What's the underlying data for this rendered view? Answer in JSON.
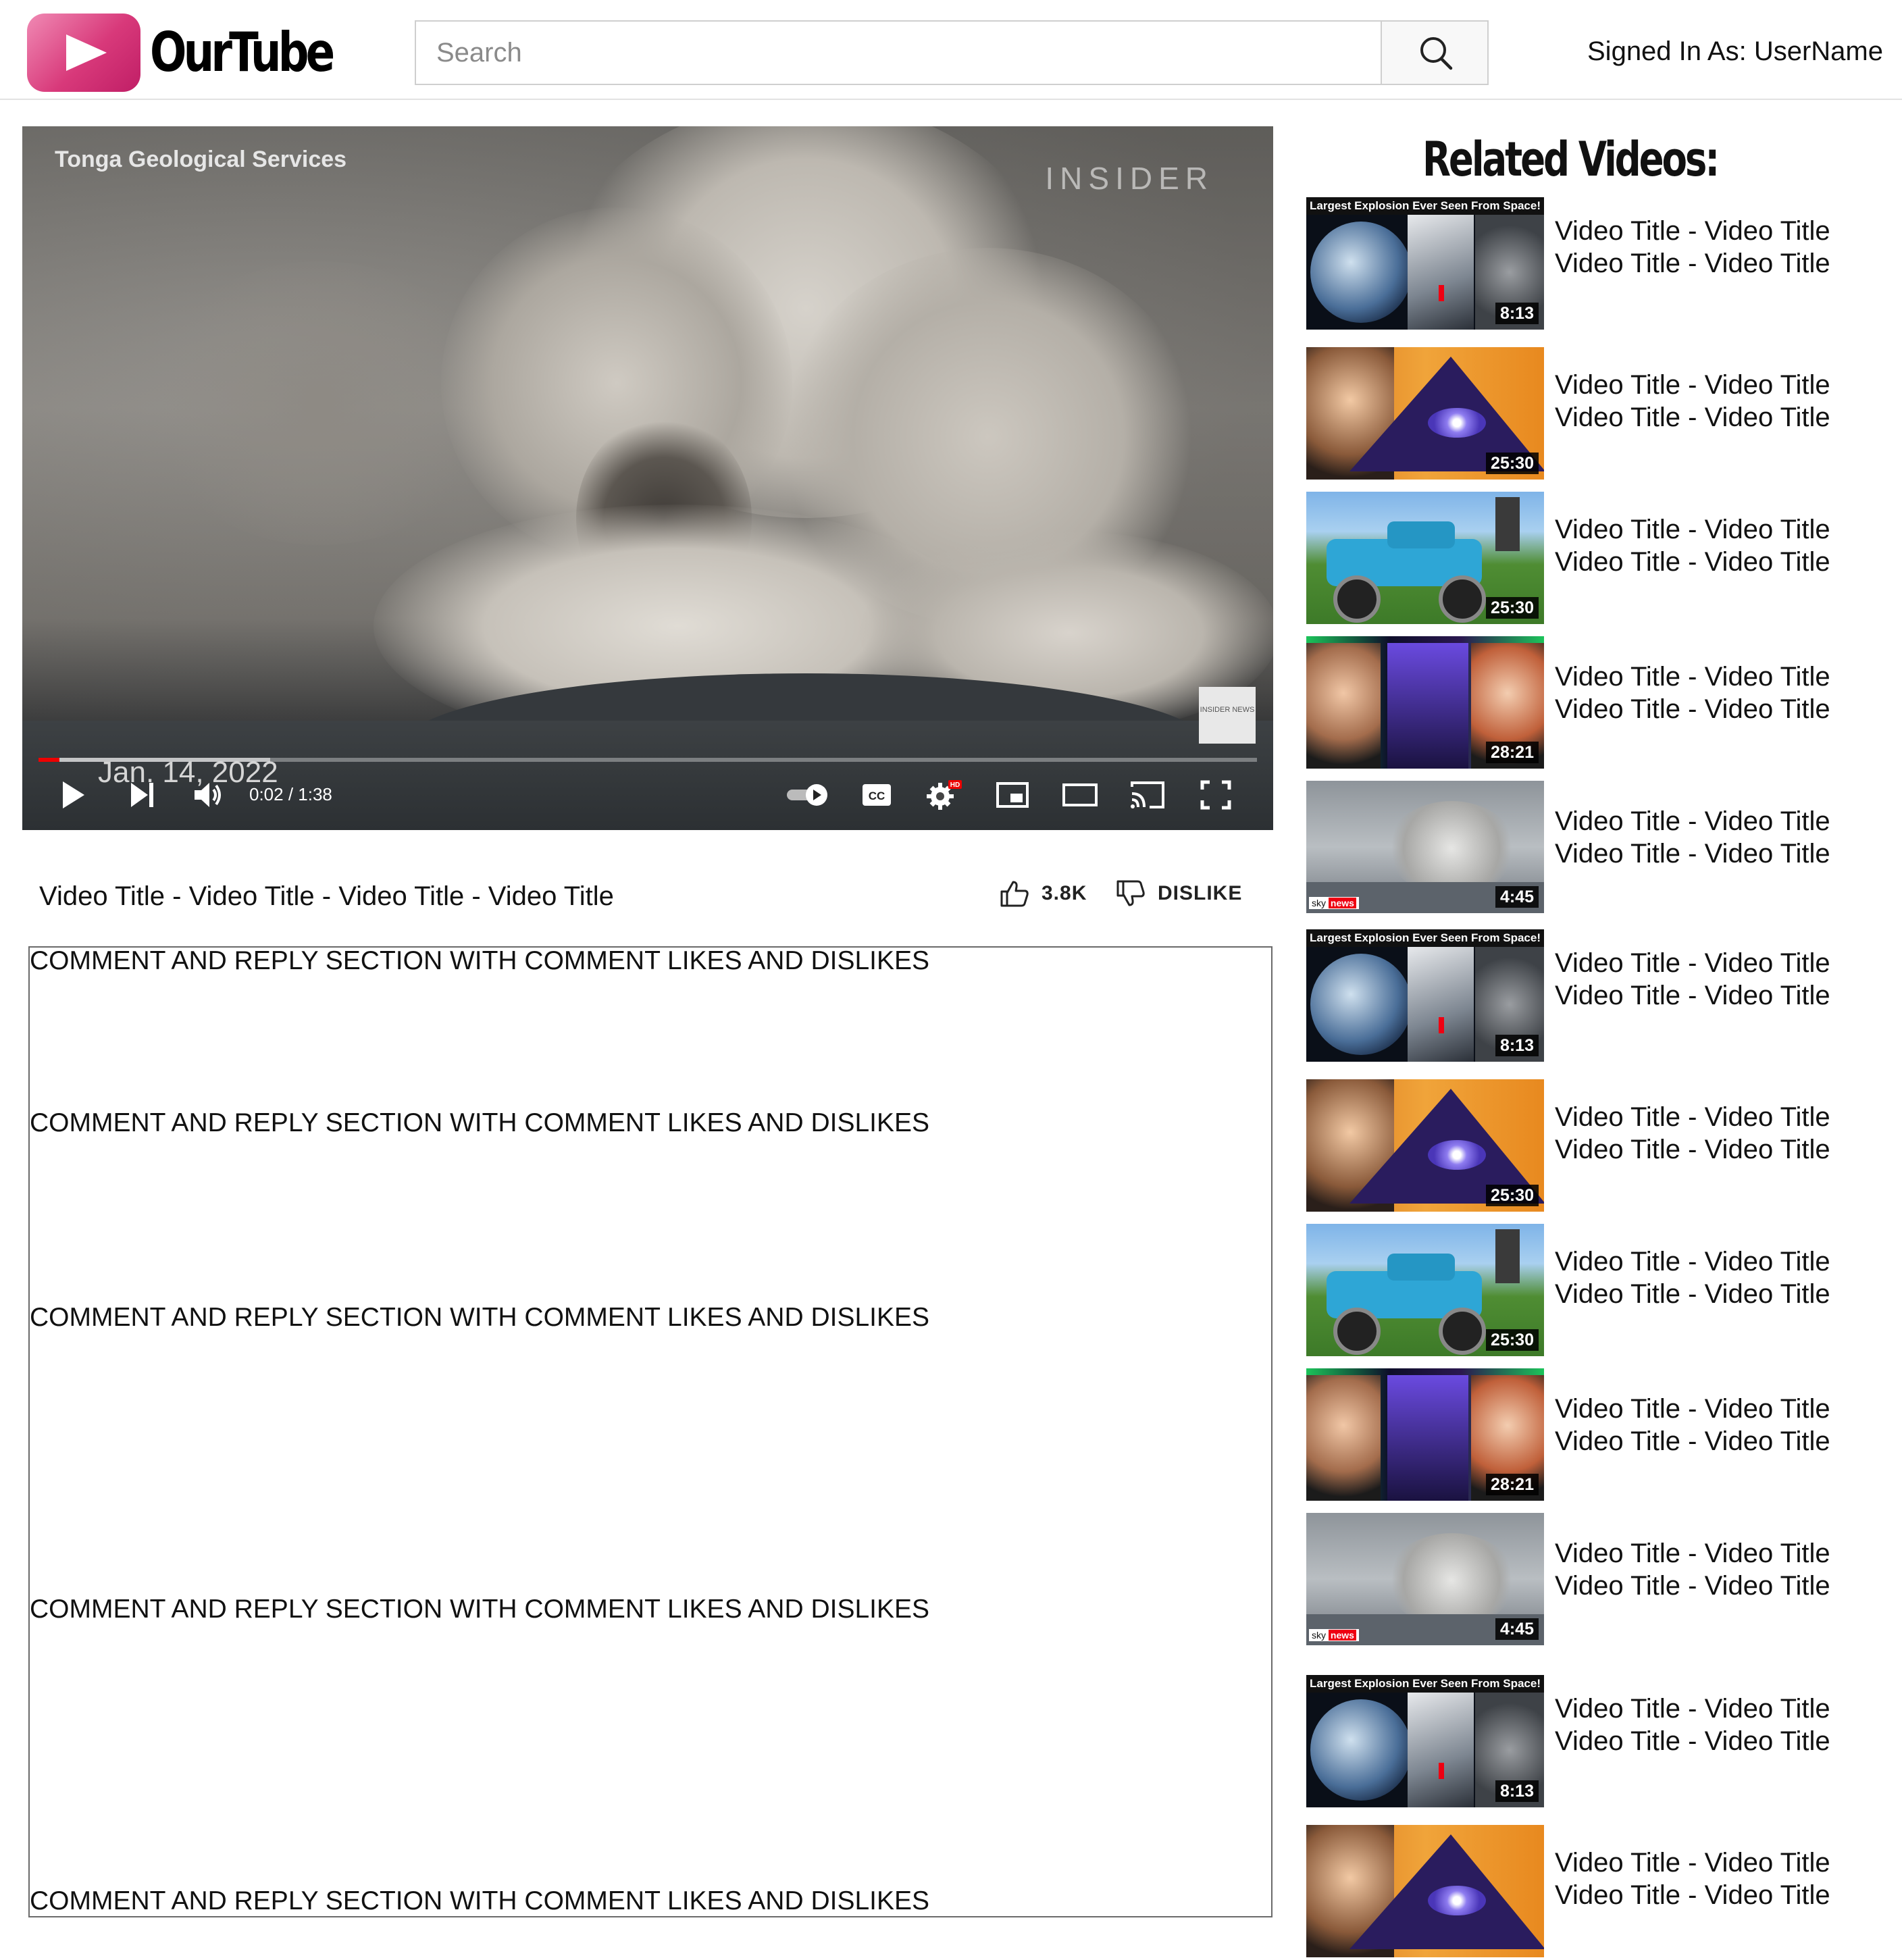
{
  "header": {
    "logo_text": "OurTube",
    "search_placeholder": "Search",
    "signed_in_text": "Signed In As: UserName"
  },
  "player": {
    "overlay_credit": "Tonga Geological Services",
    "overlay_brand": "INSIDER",
    "overlay_date": "Jan. 14, 2022",
    "news_bug": "INSIDER NEWS",
    "timecode": "0:02 / 1:38",
    "played_fraction": 0.017,
    "buffered_fraction": 0.19,
    "hd_badge": "HD"
  },
  "video": {
    "title": "Video Title - Video Title - Video Title - Video Title",
    "like_count": "3.8K",
    "dislike_label": "DISLIKE"
  },
  "comments": [
    "COMMENT AND REPLY SECTION WITH COMMENT LIKES AND DISLIKES",
    "COMMENT AND REPLY SECTION WITH COMMENT LIKES AND DISLIKES",
    "COMMENT AND REPLY SECTION WITH COMMENT LIKES AND DISLIKES",
    "COMMENT AND REPLY SECTION WITH COMMENT LIKES AND DISLIKES",
    "COMMENT AND REPLY SECTION WITH COMMENT LIKES AND DISLIKES"
  ],
  "related": {
    "heading": "Related Videos:",
    "items": [
      {
        "title1": "Video Title - Video Title",
        "title2": "Video Title - Video Title",
        "duration": "8:13",
        "thumb": "space",
        "caption": "Largest Explosion Ever Seen From Space!"
      },
      {
        "title1": "Video Title - Video Title",
        "title2": "Video Title - Video Title",
        "duration": "25:30",
        "thumb": "pyramid"
      },
      {
        "title1": "Video Title - Video Title",
        "title2": "Video Title - Video Title",
        "duration": "25:30",
        "thumb": "truck"
      },
      {
        "title1": "Video Title - Video Title",
        "title2": "Video Title - Video Title",
        "duration": "28:21",
        "thumb": "tech"
      },
      {
        "title1": "Video Title - Video Title",
        "title2": "Video Title - Video Title",
        "duration": "4:45",
        "thumb": "volcano",
        "tag_prefix": "sky",
        "tag": "news"
      },
      {
        "title1": "Video Title - Video Title",
        "title2": "Video Title - Video Title",
        "duration": "8:13",
        "thumb": "space",
        "caption": "Largest Explosion Ever Seen From Space!"
      },
      {
        "title1": "Video Title - Video Title",
        "title2": "Video Title - Video Title",
        "duration": "25:30",
        "thumb": "pyramid"
      },
      {
        "title1": "Video Title - Video Title",
        "title2": "Video Title - Video Title",
        "duration": "25:30",
        "thumb": "truck"
      },
      {
        "title1": "Video Title - Video Title",
        "title2": "Video Title - Video Title",
        "duration": "28:21",
        "thumb": "tech"
      },
      {
        "title1": "Video Title - Video Title",
        "title2": "Video Title - Video Title",
        "duration": "4:45",
        "thumb": "volcano",
        "tag_prefix": "sky",
        "tag": "news"
      },
      {
        "title1": "Video Title - Video Title",
        "title2": "Video Title - Video Title",
        "duration": "8:13",
        "thumb": "space",
        "caption": "Largest Explosion Ever Seen From Space!"
      },
      {
        "title1": "Video Title - Video Title",
        "title2": "Video Title - Video Title",
        "duration": "",
        "thumb": "pyramid"
      }
    ]
  },
  "colors": {
    "logo_gradient_start": "#f08ab4",
    "logo_gradient_end": "#c01e66",
    "progress_played": "#ee0000"
  },
  "icons": [
    "play-icon",
    "next-icon",
    "volume-icon",
    "autoplay-toggle-icon",
    "captions-icon",
    "settings-icon",
    "miniplayer-icon",
    "theater-icon",
    "cast-icon",
    "fullscreen-icon",
    "search-icon",
    "thumbs-up-icon",
    "thumbs-down-icon"
  ]
}
